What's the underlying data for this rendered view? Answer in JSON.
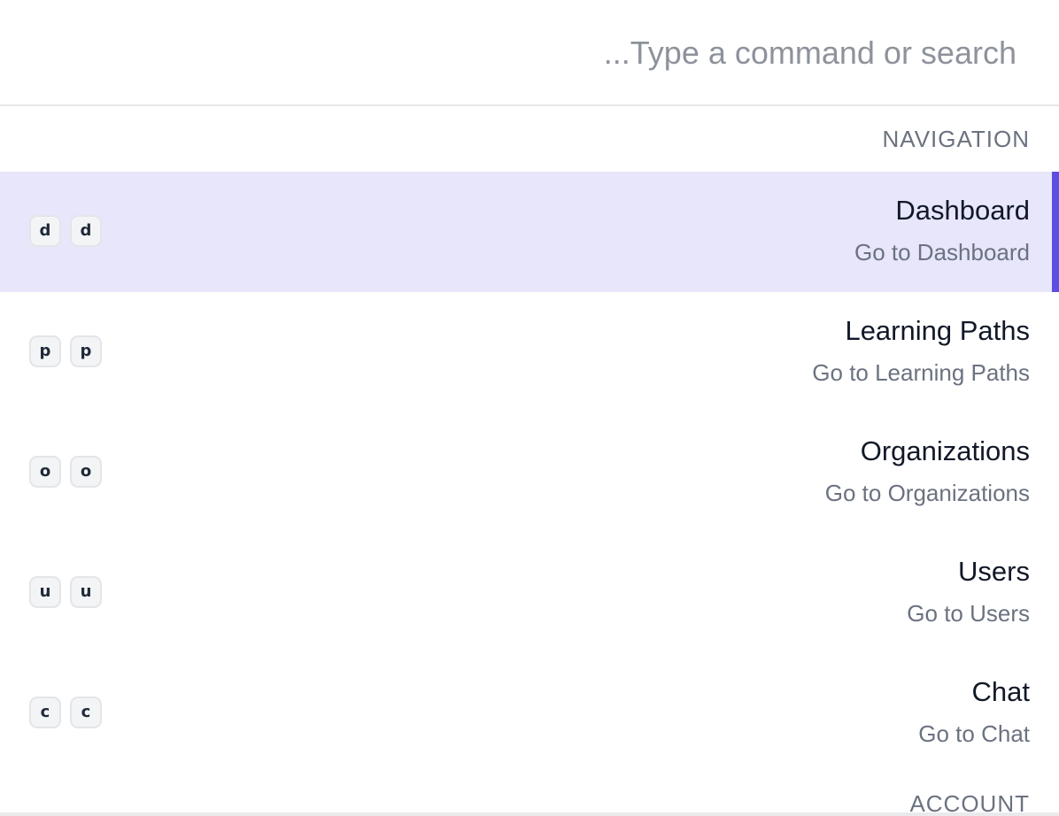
{
  "search": {
    "placeholder": "...Type a command or search",
    "value": ""
  },
  "groups": {
    "navigation": "NAVIGATION",
    "account": "ACCOUNT"
  },
  "items": [
    {
      "title": "Dashboard",
      "subtitle": "Go to Dashboard",
      "keys": [
        "d",
        "d"
      ],
      "selected": true
    },
    {
      "title": "Learning Paths",
      "subtitle": "Go to Learning Paths",
      "keys": [
        "p",
        "p"
      ],
      "selected": false
    },
    {
      "title": "Organizations",
      "subtitle": "Go to Organizations",
      "keys": [
        "o",
        "o"
      ],
      "selected": false
    },
    {
      "title": "Users",
      "subtitle": "Go to Users",
      "keys": [
        "u",
        "u"
      ],
      "selected": false
    },
    {
      "title": "Chat",
      "subtitle": "Go to Chat",
      "keys": [
        "c",
        "c"
      ],
      "selected": false
    }
  ],
  "colors": {
    "accent": "#5b4ee0",
    "selected_background": "#e7e6fb"
  }
}
